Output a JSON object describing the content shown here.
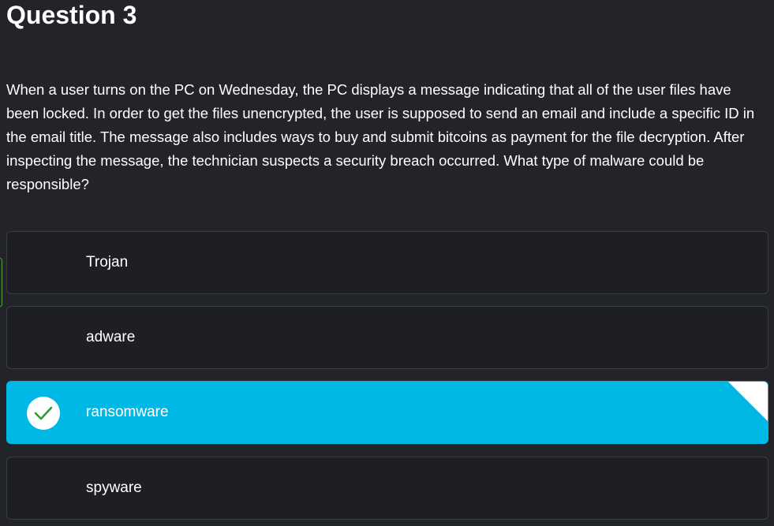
{
  "question": {
    "title": "Question 3",
    "text": "When a user turns on the PC on Wednesday, the PC displays a message indicating that all of the user files have been locked. In order to get the files unencrypted, the user is supposed to send an email and include a specific ID in the email title. The message also includes ways to buy and submit bitcoins as payment for the file decryption. After inspecting the message, the technician suspects a security breach occurred. What type of malware could be responsible?"
  },
  "answers": [
    {
      "label": "Trojan",
      "selected": false
    },
    {
      "label": "adware",
      "selected": false
    },
    {
      "label": "ransomware",
      "selected": true
    },
    {
      "label": "spyware",
      "selected": false
    }
  ],
  "colors": {
    "background": "#232429",
    "answer_background": "#1d1f25",
    "selected": "#00b8e6",
    "check": "#2e9e2e"
  },
  "icons": {
    "selected_answer_icon": "check-icon"
  }
}
